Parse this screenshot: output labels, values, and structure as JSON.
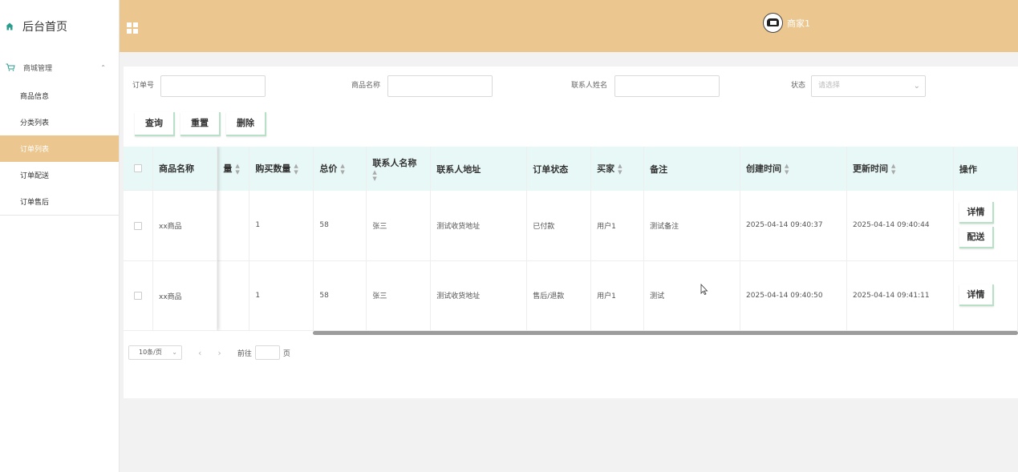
{
  "sidebar": {
    "home_label": "后台首页",
    "group_label": "商城管理",
    "items": [
      {
        "label": "商品信息",
        "active": false
      },
      {
        "label": "分类列表",
        "active": false
      },
      {
        "label": "订单列表",
        "active": true
      },
      {
        "label": "订单配送",
        "active": false
      },
      {
        "label": "订单售后",
        "active": false
      }
    ]
  },
  "header": {
    "username": "商家1"
  },
  "search": {
    "order_no_label": "订单号",
    "order_no_value": "",
    "product_name_label": "商品名称",
    "product_name_value": "",
    "contact_name_label": "联系人姓名",
    "contact_name_value": "",
    "status_label": "状态",
    "status_placeholder": "请选择"
  },
  "buttons": {
    "query": "查询",
    "reset": "重置",
    "delete": "删除"
  },
  "table": {
    "headers": {
      "product_name": "商品名称",
      "hidden_partial": "量",
      "quantity": "购买数量",
      "total": "总价",
      "contact_name": "联系人名称",
      "contact_address": "联系人地址",
      "order_status": "订单状态",
      "buyer": "买家",
      "remark": "备注",
      "created_at": "创建时间",
      "updated_at": "更新时间",
      "actions": "操作"
    },
    "rows": [
      {
        "product_name": "xx商品",
        "quantity": "1",
        "total": "58",
        "contact_name": "张三",
        "contact_address": "测试收货地址",
        "order_status": "已付款",
        "buyer": "用户1",
        "remark": "测试备注",
        "created_at": "2025-04-14 09:40:37",
        "updated_at": "2025-04-14 09:40:44",
        "actions": [
          "详情",
          "配送"
        ]
      },
      {
        "product_name": "xx商品",
        "quantity": "1",
        "total": "58",
        "contact_name": "张三",
        "contact_address": "测试收货地址",
        "order_status": "售后/退款",
        "buyer": "用户1",
        "remark": "测试",
        "created_at": "2025-04-14 09:40:50",
        "updated_at": "2025-04-14 09:41:11",
        "actions": [
          "详情"
        ]
      }
    ]
  },
  "pagination": {
    "page_size": "10条/页",
    "goto_prefix": "前往",
    "goto_suffix": "页",
    "goto_value": ""
  },
  "colors": {
    "accent": "#ebc68e",
    "table_header_bg": "#e8f8f6",
    "button_border": "#b7e0c7"
  }
}
